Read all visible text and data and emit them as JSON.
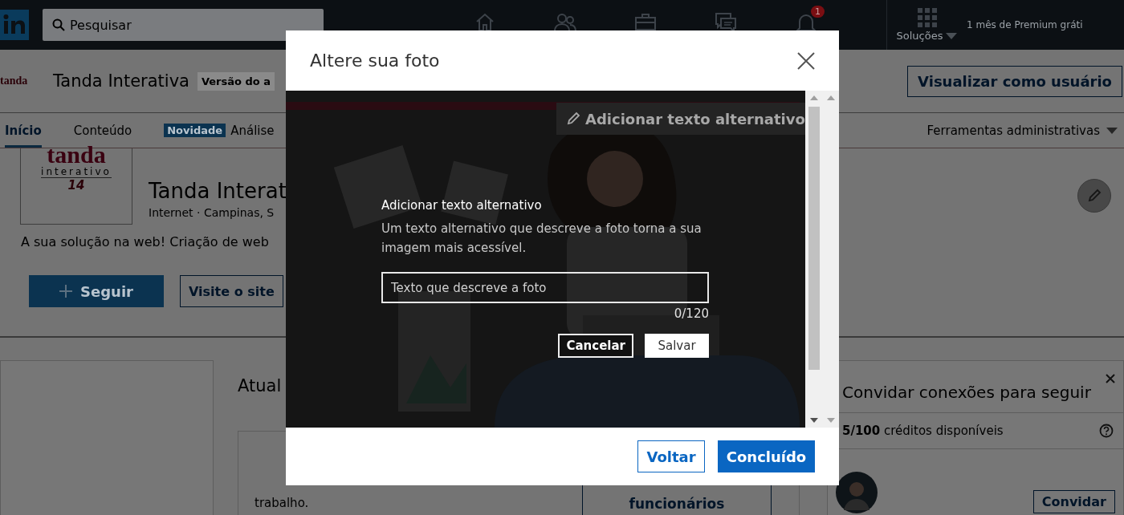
{
  "top_nav": {
    "search": {
      "placeholder": "Pesquisar"
    },
    "notification_count": "1",
    "solutions_label": "Soluções",
    "premium_link": "1 mês de Premium gráti"
  },
  "company_header": {
    "logo_text": "tanda",
    "name": "Tanda Interativa",
    "admin_chip": "Versão do a",
    "view_as_button": "Visualizar como usuário"
  },
  "tabs": [
    {
      "label": "Início",
      "selected": true
    },
    {
      "label": "Conteúdo",
      "selected": false
    },
    {
      "label": "Análise",
      "selected": false,
      "badge": "Novidade"
    }
  ],
  "admin_tools": "Ferramentas administrativas",
  "profile": {
    "logo": {
      "wordmark": "tanda",
      "tagline": "interativo",
      "years": "14"
    },
    "name": "Tanda Interat",
    "meta": "Internet · Campinas, S",
    "description": "A sua solução na web! Criação de web",
    "follow_button": "Seguir",
    "website_button": "Visite o site"
  },
  "updates": {
    "title": "Atual",
    "notify_card": {
      "text": "trabalho.",
      "button": "funcionários"
    }
  },
  "invite_panel": {
    "title": "Convidar conexões para seguir",
    "credits": "**5/100** créditos disponíveis",
    "invite_button": "Convidar"
  },
  "modal": {
    "title": "Altere sua foto",
    "alt_text_button": "Adicionar texto alternativo",
    "alt_text_form": {
      "title": "Adicionar texto alternativo",
      "description": "Um texto alternativo que descreve a foto torna a sua imagem mais acessível.",
      "input": {
        "placeholder": "Texto que descreve a foto"
      },
      "counter": "0/120",
      "cancel_button": "Cancelar",
      "save_button": "Salvar"
    },
    "back_button": "Voltar",
    "done_button": "Concluído"
  }
}
